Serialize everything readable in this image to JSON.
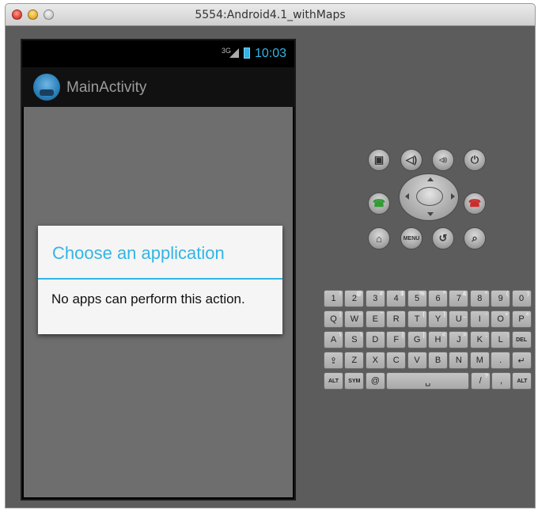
{
  "window": {
    "title": "5554:Android4.1_withMaps"
  },
  "status_bar": {
    "network": "3G",
    "time": "10:03",
    "accent": "#33b5e5"
  },
  "action_bar": {
    "title": "MainActivity"
  },
  "dialog": {
    "title": "Choose an application",
    "message": "No apps can perform this action."
  },
  "controls": {
    "row1": [
      {
        "name": "camera-icon",
        "glyph": "▣"
      },
      {
        "name": "volume-down-icon",
        "glyph": "◁)"
      },
      {
        "name": "volume-up-icon",
        "glyph": "◁))"
      },
      {
        "name": "power-icon",
        "glyph": "⏻"
      }
    ],
    "call": {
      "glyph": "☎",
      "color": "#2e9b33"
    },
    "end": {
      "glyph": "☎",
      "color": "#cc2a2a"
    },
    "row3": [
      {
        "name": "home-icon",
        "glyph": "⌂"
      },
      {
        "name": "menu-button",
        "glyph": "MENU"
      },
      {
        "name": "back-icon",
        "glyph": "↺"
      },
      {
        "name": "search-icon",
        "glyph": "⌕"
      }
    ]
  },
  "keyboard": {
    "rows": [
      [
        {
          "k": "1",
          "s": "!"
        },
        {
          "k": "2",
          "s": "@"
        },
        {
          "k": "3",
          "s": "#"
        },
        {
          "k": "4",
          "s": "$"
        },
        {
          "k": "5",
          "s": "%"
        },
        {
          "k": "6",
          "s": "^"
        },
        {
          "k": "7",
          "s": "&"
        },
        {
          "k": "8",
          "s": "*"
        },
        {
          "k": "9",
          "s": "("
        },
        {
          "k": "0",
          "s": ")"
        }
      ],
      [
        {
          "k": "Q",
          "s": "|"
        },
        {
          "k": "W",
          "s": "~"
        },
        {
          "k": "E",
          "s": "\""
        },
        {
          "k": "R",
          "s": "`"
        },
        {
          "k": "T",
          "s": "{"
        },
        {
          "k": "Y",
          "s": "}"
        },
        {
          "k": "U",
          "s": "_"
        },
        {
          "k": "I",
          "s": "-"
        },
        {
          "k": "O",
          "s": "+"
        },
        {
          "k": "P",
          "s": "="
        }
      ],
      [
        {
          "k": "A",
          "s": "\\"
        },
        {
          "k": "S",
          "s": "\\"
        },
        {
          "k": "D",
          "s": "'"
        },
        {
          "k": "F",
          "s": "["
        },
        {
          "k": "G",
          "s": "]"
        },
        {
          "k": "H",
          "s": "<"
        },
        {
          "k": "J",
          "s": ">"
        },
        {
          "k": "K",
          "s": ";"
        },
        {
          "k": "L",
          "s": ":"
        },
        {
          "k": "DEL",
          "s": ""
        }
      ],
      [
        {
          "k": "⇪",
          "s": ""
        },
        {
          "k": "Z",
          "s": ""
        },
        {
          "k": "X",
          "s": ""
        },
        {
          "k": "C",
          "s": ""
        },
        {
          "k": "V",
          "s": ""
        },
        {
          "k": "B",
          "s": ""
        },
        {
          "k": "N",
          "s": ""
        },
        {
          "k": "M",
          "s": ""
        },
        {
          "k": ".",
          "s": ""
        },
        {
          "k": "↵",
          "s": ""
        }
      ],
      [
        {
          "k": "ALT",
          "s": ""
        },
        {
          "k": "SYM",
          "s": ""
        },
        {
          "k": "@",
          "s": ""
        },
        {
          "k": "␣",
          "s": ""
        },
        {
          "k": "/",
          "s": "?"
        },
        {
          "k": ",",
          "s": ""
        },
        {
          "k": "ALT",
          "s": ""
        }
      ]
    ]
  }
}
